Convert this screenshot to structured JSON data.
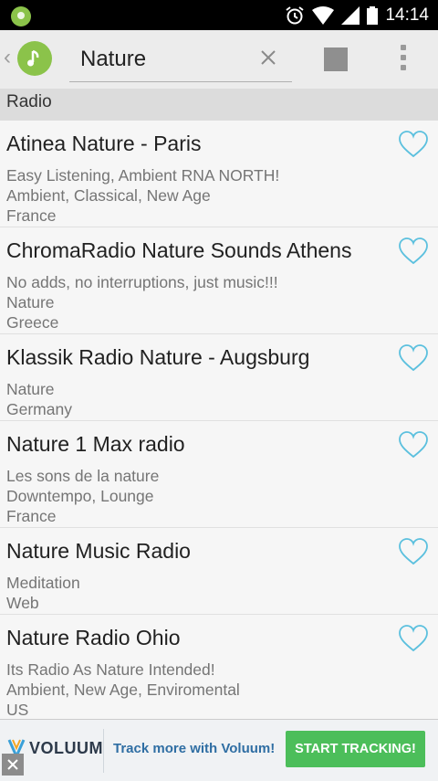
{
  "status_bar": {
    "time": "14:14"
  },
  "toolbar": {
    "search_value": "Nature"
  },
  "section": {
    "label": "Radio"
  },
  "stations": [
    {
      "title": "Atinea Nature - Paris",
      "lines": [
        "Easy Listening, Ambient RNA NORTH!",
        "Ambient, Classical, New Age",
        "France"
      ]
    },
    {
      "title": "ChromaRadio Nature Sounds Athens",
      "lines": [
        "No adds, no interruptions, just music!!!",
        "Nature",
        "Greece"
      ]
    },
    {
      "title": "Klassik Radio Nature - Augsburg",
      "lines": [
        "Nature",
        "Germany"
      ]
    },
    {
      "title": "Nature 1 Max radio",
      "lines": [
        "Les sons de la nature",
        "Downtempo, Lounge",
        "France"
      ]
    },
    {
      "title": "Nature Music Radio",
      "lines": [
        "Meditation",
        "Web"
      ]
    },
    {
      "title": "Nature Radio Ohio",
      "lines": [
        "Its Radio As Nature Intended!",
        "Ambient, New Age, Enviromental",
        "US"
      ]
    }
  ],
  "ad": {
    "brand": "VOLUUM",
    "text": "Track more with Voluum!",
    "cta": "START TRACKING!"
  },
  "colors": {
    "accent_green": "#8bc34a",
    "heart_blue": "#5bc0de",
    "cta_green": "#4cbe5a"
  }
}
